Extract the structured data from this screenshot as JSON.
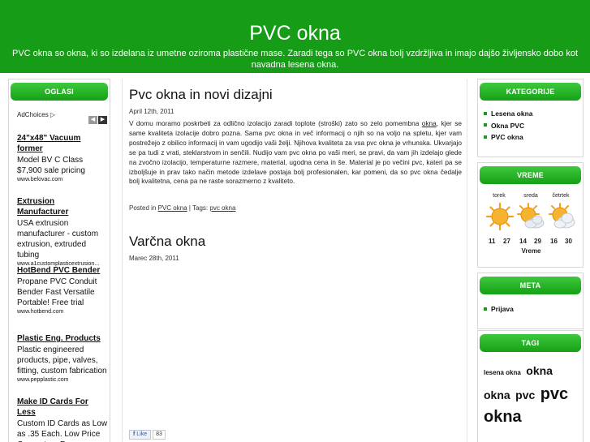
{
  "header": {
    "title": "PVC okna",
    "description": "PVC okna so okna, ki so izdelana iz umetne oziroma plastične mase. Zaradi tega so PVC okna bolj vzdržljiva in imajo dajšo življensko dobo kot navadna lesena okna."
  },
  "left": {
    "heading": "OGLASI",
    "adchoices": "AdChoices ▷",
    "ads": [
      {
        "title": "24\"x48\" Vacuum former",
        "text": "Model BV C Class $7,900 sale pricing",
        "url": "www.belovac.com"
      },
      {
        "title": "Extrusion Manufacturer",
        "text": "USA extrusion manufacturer - custom extrusion, extruded tubing",
        "url": "www.a1customplasticextrusion..."
      },
      {
        "title": "HotBend PVC Bender",
        "text": "Propane PVC Conduit Bender Fast Versatile Portable! Free trial",
        "url": "www.hotbend.com"
      },
      {
        "title": "Plastic Eng. Products",
        "text": "Plastic engineered products, pipe, valves, fitting, custom fabrication",
        "url": "www.pepplastic.com"
      },
      {
        "title": "Make ID Cards For Less",
        "text": "Custom ID Cards as Low as .35 Each. Low Price Guarantee, Free",
        "url": ""
      }
    ]
  },
  "posts": [
    {
      "title": "Pvc okna in novi dizajni",
      "date": "April 12th, 2011",
      "body_before": "V domu moramo poskrbeti za odlično izolacijo zaradi toplote (stroški) zato so zelo pomembna ",
      "body_link": "okna",
      "body_after": ", kjer se same kvaliteta izolacije dobro pozna. Sama pvc okna in več informacij o njih so na voljo na spletu, kjer vam postrežejo z obilico informacij in vam ugodijo vaši želji. Njihova kvaliteta za vsa pvc okna je vrhunska. Ukvarjajo se pa tudi z vrati, steklarstvom in senčili. Nudijo vam pvc okna po vaši meri, se pravi, da vam jih izdelajo glede na zvočno izolacijo, temperaturne razmere, material, ugodna cena in še. Material je po večini pvc, kateri pa se izboljšuje in prav tako način metode izdelave postaja bolj profesionalen, kar pomeni, da so pvc okna čedalje bolj kvalitetna, cena pa ne raste sorazmerno z kvaliteto.",
      "posted_in_label": "Posted in",
      "category": "PVC okna",
      "tags_label": "| Tags:",
      "tag": "pvc okna"
    },
    {
      "title": "Varčna okna",
      "date": "Marec 28th, 2011"
    }
  ],
  "like": {
    "label": "Like",
    "count": "83"
  },
  "categories": {
    "heading": "KATEGORIJE",
    "items": [
      "Lesena okna",
      "Okna PVC",
      "PVC okna"
    ]
  },
  "weather": {
    "heading": "VREME",
    "days": [
      {
        "name": "torek",
        "icon": "sun-icon",
        "high": "11",
        "low": "27"
      },
      {
        "name": "sreda",
        "icon": "sun-cloud-icon",
        "high": "14",
        "low": "29"
      },
      {
        "name": "četrtek",
        "icon": "sun-cloud-icon",
        "high": "16",
        "low": "30"
      }
    ],
    "label": "Vreme"
  },
  "meta": {
    "heading": "META",
    "items": [
      "Prijava"
    ]
  },
  "tags": {
    "heading": "TAGI",
    "items": [
      "lesena okna",
      "okna",
      "okna",
      "pvc",
      "pvc",
      "okna"
    ]
  },
  "colors": {
    "brand_green": "#169c16",
    "button_green": "#2fb82f"
  }
}
